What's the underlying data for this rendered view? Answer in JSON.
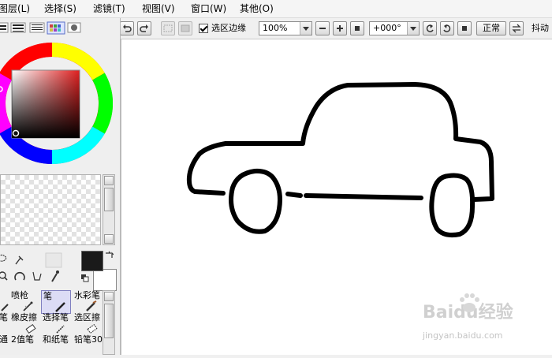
{
  "menu": {
    "items": [
      "图层(L)",
      "选择(S)",
      "滤镜(T)",
      "视图(V)",
      "窗口(W)",
      "其他(O)"
    ]
  },
  "toolbar": {
    "selection_edge_label": "选区边缘",
    "selection_edge_checked": true,
    "zoom_value": "100%",
    "rotation_value": "+000°",
    "blend_mode_label": "正常",
    "stabilizer_label": "抖动"
  },
  "tools": {
    "row1": [
      "",
      "喷枪",
      "笔",
      "水彩笔"
    ],
    "row2": [
      "笔",
      "橡皮擦",
      "选择笔",
      "选区擦"
    ],
    "row3": [
      "通",
      "2值笔",
      "和纸笔",
      "铅笔30"
    ]
  },
  "watermark": {
    "brand": "Baidu经验",
    "url": "jingyan.baidu.com"
  },
  "colors": {
    "foreground": "#1a1a1a",
    "background": "#ffffff",
    "selected_tool": "#dcdcf5"
  }
}
